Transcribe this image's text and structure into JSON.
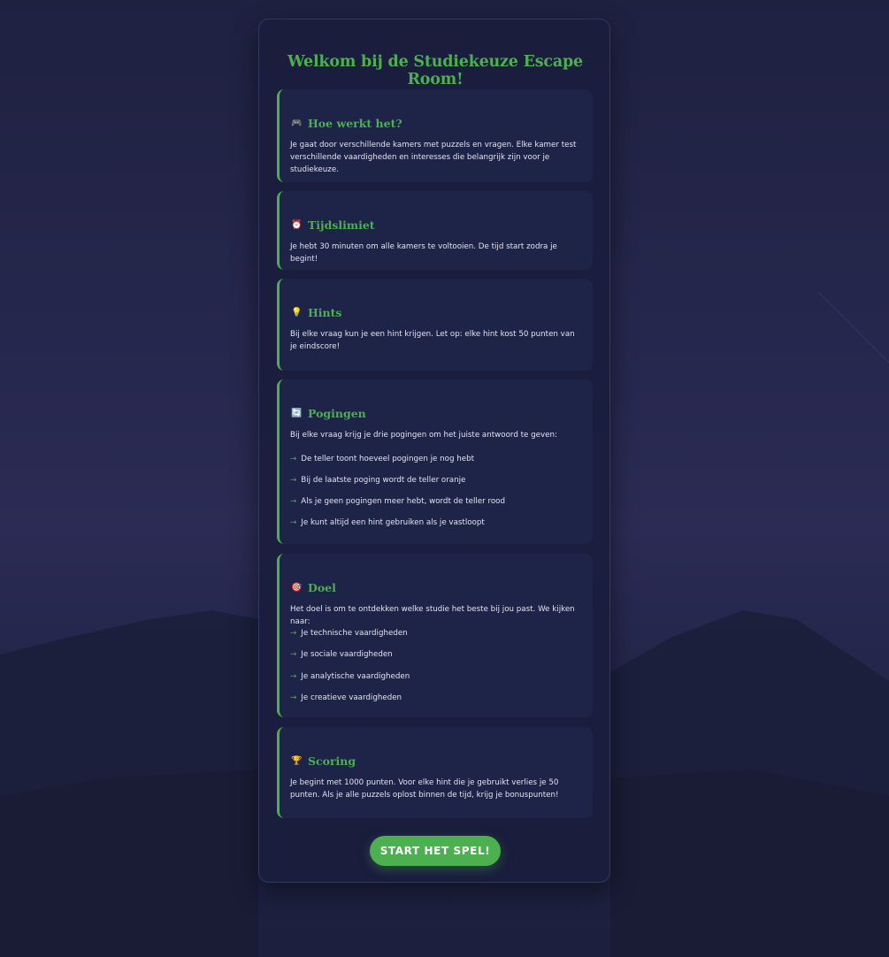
{
  "title": "Welkom bij de Studiekeuze Escape Room!",
  "sections": [
    {
      "icon": "gamepad-icon",
      "glyph": "🎮",
      "heading": "Hoe werkt het?",
      "text": "Je gaat door verschillende kamers met puzzels en vragen. Elke kamer test verschillende vaardigheden en interesses die belangrijk zijn voor je studiekeuze."
    },
    {
      "icon": "alarm-clock-icon",
      "glyph": "⏰",
      "heading": "Tijdslimiet",
      "text": "Je hebt 30 minuten om alle kamers te voltooien. De tijd start zodra je begint!"
    },
    {
      "icon": "lightbulb-icon",
      "glyph": "💡",
      "heading": "Hints",
      "text": "Bij elke vraag kun je een hint krijgen. Let op: elke hint kost 50 punten van je eindscore!"
    },
    {
      "icon": "refresh-icon",
      "glyph": "🔄",
      "heading": "Pogingen",
      "text": "Bij elke vraag krijg je drie pogingen om het juiste antwoord te geven:",
      "items": [
        "De teller toont hoeveel pogingen je nog hebt",
        "Bij de laatste poging wordt de teller oranje",
        "Als je geen pogingen meer hebt, wordt de teller rood",
        "Je kunt altijd een hint gebruiken als je vastloopt"
      ]
    },
    {
      "icon": "target-icon",
      "glyph": "🎯",
      "heading": "Doel",
      "text": "Het doel is om te ontdekken welke studie het beste bij jou past. We kijken naar:",
      "items": [
        "Je technische vaardigheden",
        "Je sociale vaardigheden",
        "Je analytische vaardigheden",
        "Je creatieve vaardigheden"
      ]
    },
    {
      "icon": "trophy-icon",
      "glyph": "🏆",
      "heading": "Scoring",
      "text": "Je begint met 1000 punten. Voor elke hint die je gebruikt verlies je 50 punten. Als je alle puzzels oplost binnen de tijd, krijg je bonuspunten!"
    }
  ],
  "list_arrow": "→",
  "start_button": "START HET SPEL!",
  "colors": {
    "accent": "#4caf50",
    "card_bg": "#1a1d3c",
    "section_bg": "#1d2447",
    "text": "#e3e4ef"
  }
}
